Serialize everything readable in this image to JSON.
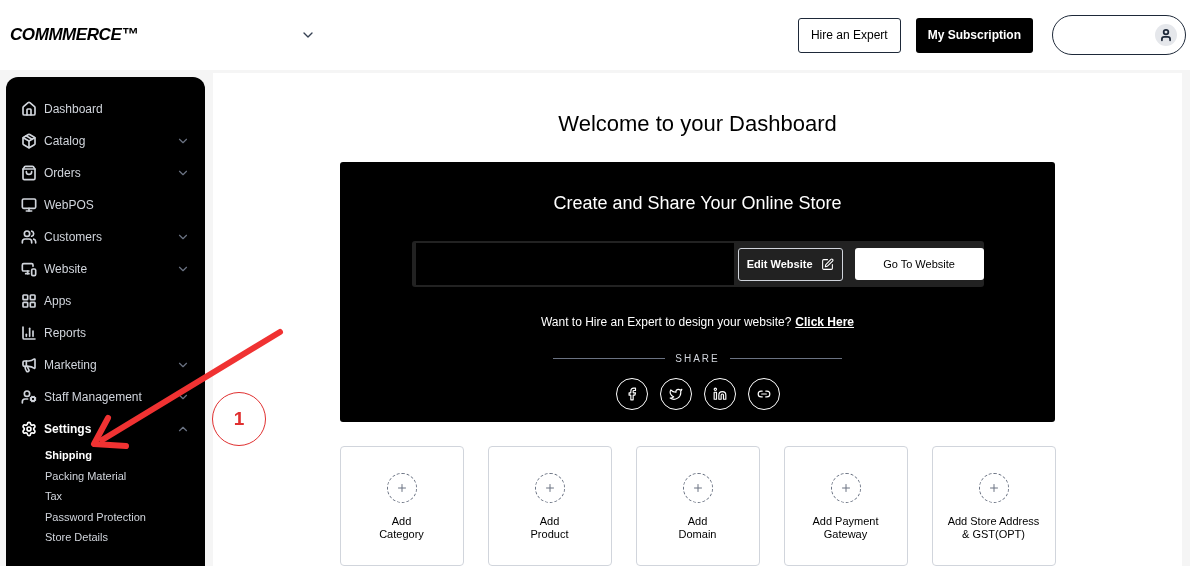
{
  "header": {
    "logo": "COMMMERCE™",
    "buttons": [
      {
        "label": "Hire an Expert",
        "kind": "outline"
      },
      {
        "label": "My Subscription",
        "kind": "solid"
      }
    ]
  },
  "sidebar": {
    "items": [
      {
        "label": "Dashboard"
      },
      {
        "label": "Catalog",
        "expanded": false
      },
      {
        "label": "Orders",
        "expanded": false
      },
      {
        "label": "WebPOS"
      },
      {
        "label": "Customers",
        "expanded": false
      },
      {
        "label": "Website",
        "expanded": false
      },
      {
        "label": "Apps"
      },
      {
        "label": "Reports"
      },
      {
        "label": "Marketing",
        "expanded": false
      },
      {
        "label": "Staff Management",
        "expanded": false
      },
      {
        "label": "Settings",
        "expanded": true,
        "children": [
          {
            "label": "Shipping",
            "selected": true
          },
          {
            "label": "Packing Material",
            "selected": false
          },
          {
            "label": "Tax",
            "selected": false
          },
          {
            "label": "Password Protection",
            "selected": false
          },
          {
            "label": "Store Details",
            "selected": false
          }
        ]
      }
    ]
  },
  "main": {
    "title": "Welcome to your Dashboard",
    "store_card": {
      "title": "Create and Share Your Online Store",
      "edit_button": "Edit Website",
      "go_button": "Go To Website",
      "hire_text": "Want to Hire an Expert to design your website?",
      "hire_link": "Click Here",
      "share_label": "SHARE"
    },
    "action_cards": [
      {
        "label": "Add\nCategory"
      },
      {
        "label": "Add\nProduct"
      },
      {
        "label": "Add\nDomain"
      },
      {
        "label": "Add Payment\nGateway"
      },
      {
        "label": "Add Store Address\n& GST(OPT)"
      }
    ]
  },
  "annotation": {
    "step": "1"
  }
}
